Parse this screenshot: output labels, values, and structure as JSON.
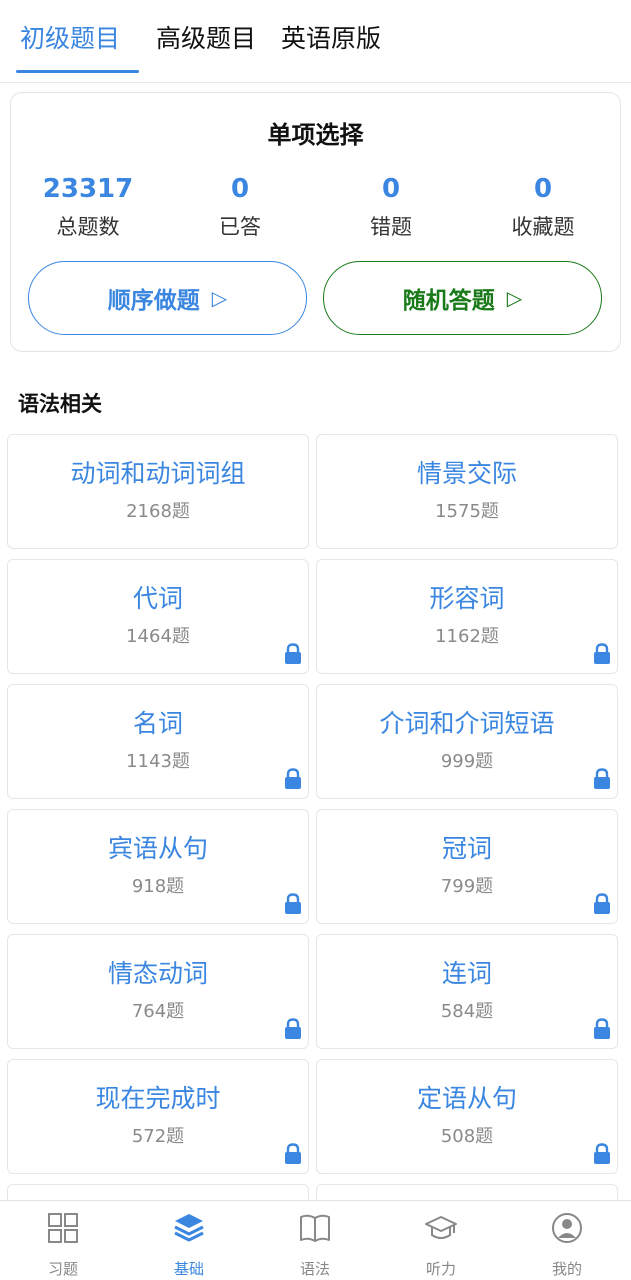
{
  "tabs": [
    {
      "label": "初级题目",
      "active": true
    },
    {
      "label": "高级题目",
      "active": false
    },
    {
      "label": "英语原版",
      "active": false
    }
  ],
  "summary": {
    "title": "单项选择",
    "stats": [
      {
        "value": "23317",
        "label": "总题数"
      },
      {
        "value": "0",
        "label": "已答"
      },
      {
        "value": "0",
        "label": "错题"
      },
      {
        "value": "0",
        "label": "收藏题"
      }
    ],
    "sequential_button": "顺序做题",
    "random_button": "随机答题",
    "play_glyph": "▷"
  },
  "section_title": "语法相关",
  "categories": [
    {
      "name": "动词和动词词组",
      "count": "2168题",
      "locked": false
    },
    {
      "name": "情景交际",
      "count": "1575题",
      "locked": false
    },
    {
      "name": "代词",
      "count": "1464题",
      "locked": true
    },
    {
      "name": "形容词",
      "count": "1162题",
      "locked": true
    },
    {
      "name": "名词",
      "count": "1143题",
      "locked": true
    },
    {
      "name": "介词和介词短语",
      "count": "999题",
      "locked": true
    },
    {
      "name": "宾语从句",
      "count": "918题",
      "locked": true
    },
    {
      "name": "冠词",
      "count": "799题",
      "locked": true
    },
    {
      "name": "情态动词",
      "count": "764题",
      "locked": true
    },
    {
      "name": "连词",
      "count": "584题",
      "locked": true
    },
    {
      "name": "现在完成时",
      "count": "572题",
      "locked": true
    },
    {
      "name": "定语从句",
      "count": "508题",
      "locked": true
    }
  ],
  "bottom_nav": [
    {
      "label": "习题",
      "icon": "grid-icon",
      "active": false
    },
    {
      "label": "基础",
      "icon": "layers-icon",
      "active": true
    },
    {
      "label": "语法",
      "icon": "book-icon",
      "active": false
    },
    {
      "label": "听力",
      "icon": "graduation-cap-icon",
      "active": false
    },
    {
      "label": "我的",
      "icon": "user-icon",
      "active": false
    }
  ],
  "colors": {
    "accent": "#3a86e0",
    "green": "#1a7a1a",
    "muted": "#8a8a8a"
  }
}
